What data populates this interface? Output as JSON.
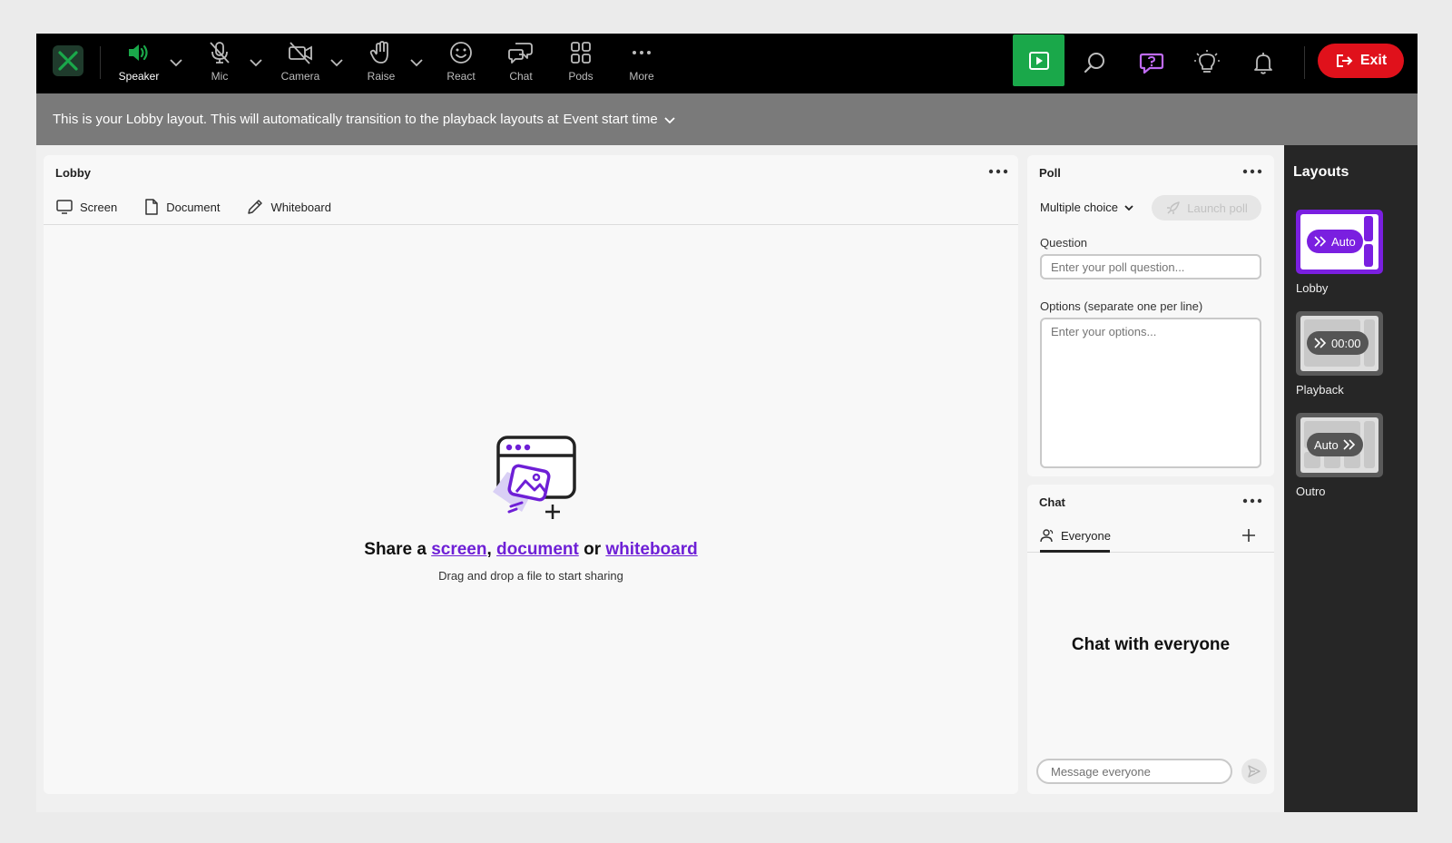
{
  "toolbar": {
    "speaker": "Speaker",
    "mic": "Mic",
    "camera": "Camera",
    "raise": "Raise",
    "react": "React",
    "chat": "Chat",
    "pods": "Pods",
    "more": "More",
    "exit": "Exit"
  },
  "banner": {
    "text": "This is your Lobby layout. This will automatically transition to the playback layouts at",
    "select": "Event start time"
  },
  "lobby": {
    "title": "Lobby",
    "tabs": [
      "Screen",
      "Document",
      "Whiteboard"
    ],
    "share_prefix": "Share a",
    "share_link_screen": "screen",
    "share_comma": ",",
    "share_link_document": "document",
    "share_or": "or",
    "share_link_whiteboard": "whiteboard",
    "hint": "Drag and drop a file to start sharing"
  },
  "poll": {
    "title": "Poll",
    "type": "Multiple choice",
    "launch": "Launch poll",
    "question_label": "Question",
    "question_placeholder": "Enter your poll question...",
    "options_label": "Options (separate one per line)",
    "options_placeholder": "Enter your options..."
  },
  "chat": {
    "title": "Chat",
    "tab": "Everyone",
    "empty": "Chat with everyone",
    "placeholder": "Message everyone"
  },
  "layouts": {
    "title": "Layouts",
    "items": [
      {
        "name": "Lobby",
        "pill": "Auto",
        "selected": true
      },
      {
        "name": "Playback",
        "pill": "00:00",
        "selected": false
      },
      {
        "name": "Outro",
        "pill": "Auto",
        "selected": false
      }
    ]
  },
  "colors": {
    "accent": "#7a1fe0",
    "play": "#1aa84a",
    "exit": "#e0111b"
  }
}
